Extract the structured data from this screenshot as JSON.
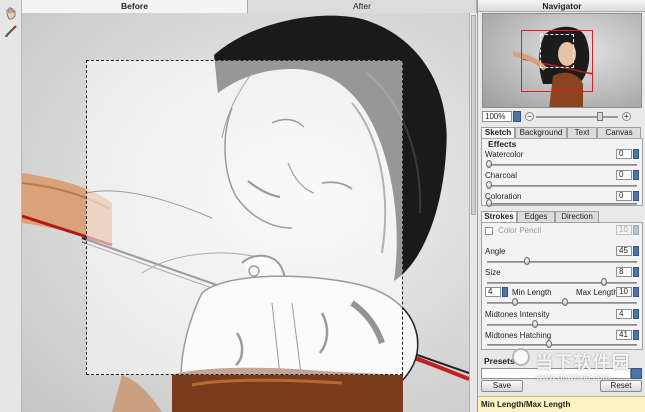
{
  "tabs": {
    "before": "Before",
    "after": "After"
  },
  "navigator": {
    "title": "Navigator",
    "zoom": "100%",
    "zoom_fraction": 0.8
  },
  "panel_tabs": [
    "Sketch",
    "Background",
    "Text",
    "Canvas"
  ],
  "effects": {
    "title": "Effects",
    "items": [
      {
        "label": "Watercolor",
        "value": "0"
      },
      {
        "label": "Charcoal",
        "value": "0"
      },
      {
        "label": "Coloration",
        "value": "0"
      }
    ]
  },
  "stroke_tabs": [
    "Strokes",
    "Edges",
    "Direction"
  ],
  "strokes": {
    "color_pencil": {
      "label": "Color Pencil",
      "value": "10",
      "checked": false
    },
    "angle": {
      "label": "Angle",
      "value": "45"
    },
    "size": {
      "label": "Size",
      "value": "8"
    },
    "min_length": {
      "label": "Min Length",
      "value": "4"
    },
    "max_length": {
      "label": "Max Length",
      "value": "10"
    },
    "midtones_intensity": {
      "label": "Midtones Intensity",
      "value": "4"
    },
    "midtones_hatching": {
      "label": "Midtones Hatching",
      "value": "41"
    }
  },
  "presets": {
    "title": "Presets",
    "save_label": "Save",
    "reset_label": "Reset"
  },
  "hint": {
    "title": "Min Length/Max Length"
  },
  "watermark": {
    "text": "当下软件园",
    "url": "www.downxia.com"
  },
  "colors": {
    "accent": "#4a76a8",
    "selection": "#e02020",
    "hint_bg": "#fbf3c4"
  }
}
